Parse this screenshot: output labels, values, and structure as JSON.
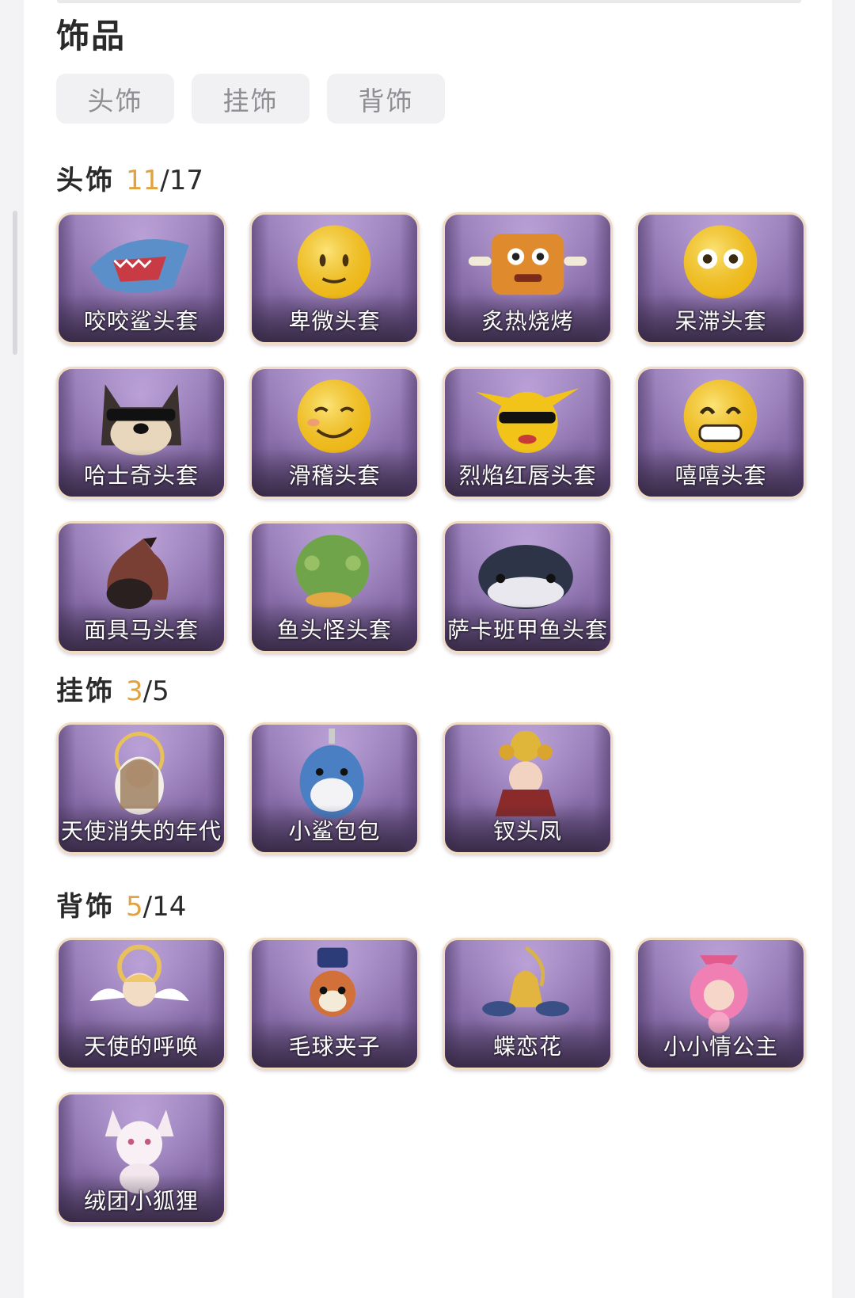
{
  "header": {
    "title": "饰品"
  },
  "tabs": [
    {
      "label": "头饰"
    },
    {
      "label": "挂饰"
    },
    {
      "label": "背饰"
    }
  ],
  "sections": [
    {
      "name": "头饰",
      "owned": "11",
      "total": "17",
      "items": [
        {
          "label": "咬咬鲨头套",
          "icon": "shark-head-icon"
        },
        {
          "label": "卑微头套",
          "icon": "humble-face-icon"
        },
        {
          "label": "炙热烧烤",
          "icon": "bbq-meat-icon"
        },
        {
          "label": "呆滞头套",
          "icon": "dazed-face-icon"
        },
        {
          "label": "哈士奇头套",
          "icon": "husky-head-icon"
        },
        {
          "label": "滑稽头套",
          "icon": "funny-face-icon"
        },
        {
          "label": "烈焰红唇头套",
          "icon": "yellow-creature-icon"
        },
        {
          "label": "嘻嘻头套",
          "icon": "grin-face-icon"
        },
        {
          "label": "面具马头套",
          "icon": "horse-head-icon"
        },
        {
          "label": "鱼头怪头套",
          "icon": "fish-head-icon"
        },
        {
          "label": "萨卡班甲鱼头套",
          "icon": "sacabambaspis-icon"
        }
      ]
    },
    {
      "name": "挂饰",
      "owned": "3",
      "total": "5",
      "items": [
        {
          "label": "天使消失的年代",
          "icon": "angel-doll-icon"
        },
        {
          "label": "小鲨包包",
          "icon": "shark-bag-icon"
        },
        {
          "label": "钗头凤",
          "icon": "phoenix-doll-icon"
        }
      ]
    },
    {
      "name": "背饰",
      "owned": "5",
      "total": "14",
      "items": [
        {
          "label": "天使的呼唤",
          "icon": "angel-wings-icon"
        },
        {
          "label": "毛球夹子",
          "icon": "raccoon-clip-icon"
        },
        {
          "label": "蝶恋花",
          "icon": "bell-ornament-icon"
        },
        {
          "label": "小小情公主",
          "icon": "pink-princess-icon"
        },
        {
          "label": "绒团小狐狸",
          "icon": "fox-doll-icon"
        }
      ]
    }
  ],
  "colors": {
    "accent": "#e2a23e",
    "card_border": "#efdcc2",
    "card_bg": "#8a6fab"
  }
}
